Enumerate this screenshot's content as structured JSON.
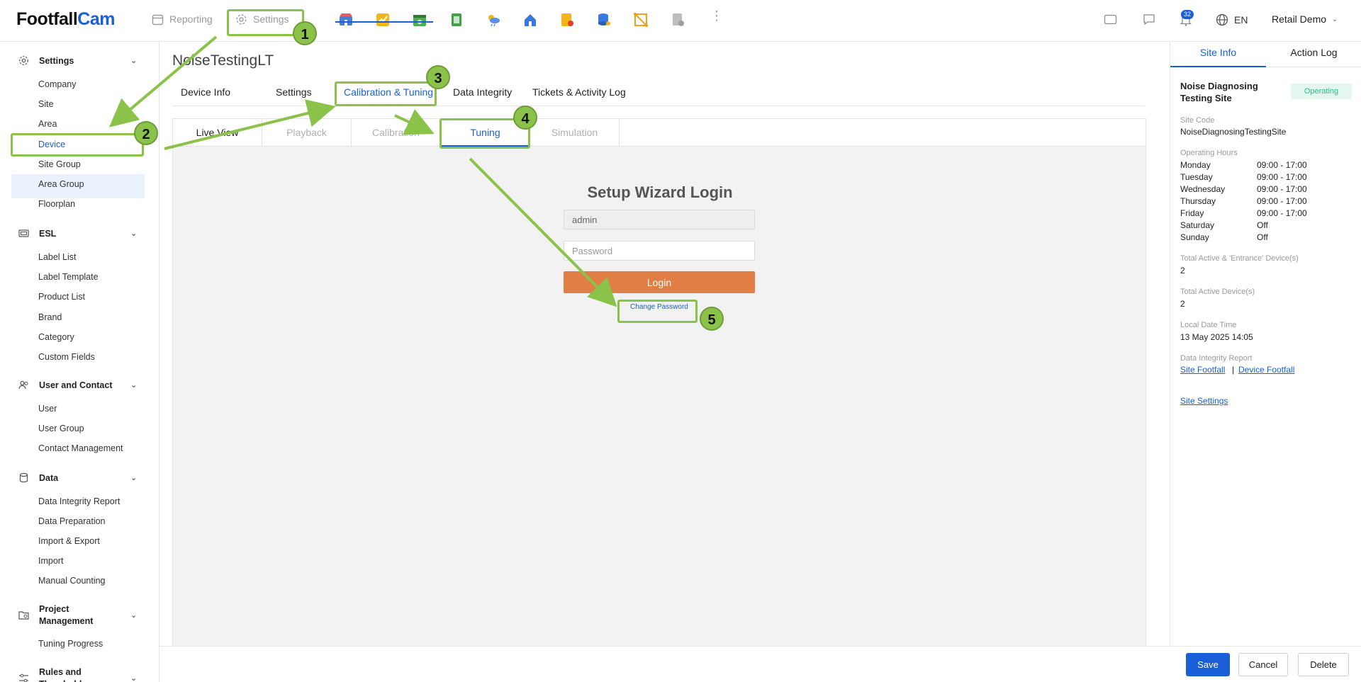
{
  "app": {
    "logo_part1": "Footfall",
    "logo_part2": "Cam",
    "nav_reporting": "Reporting",
    "nav_settings": "Settings",
    "notification_count": "32",
    "language": "EN",
    "user_name": "Retail Demo"
  },
  "app_icons": [
    "retail-store-icon",
    "analytics-chart-icon",
    "calendar-icon",
    "spreadsheet-icon",
    "weather-icon",
    "home-icon",
    "alert-document-icon",
    "database-icon",
    "floorplan-icon",
    "report-export-icon"
  ],
  "sidebar": {
    "groups": [
      {
        "label": "Settings",
        "icon": "gear-icon",
        "items": [
          "Company",
          "Site",
          "Area",
          "Device",
          "Site Group",
          "Area Group",
          "Floorplan"
        ]
      },
      {
        "label": "ESL",
        "icon": "esl-icon",
        "items": [
          "Label List",
          "Label Template",
          "Product List",
          "Brand",
          "Category",
          "Custom Fields"
        ]
      },
      {
        "label": "User and Contact",
        "icon": "users-icon",
        "items": [
          "User",
          "User Group",
          "Contact Management"
        ]
      },
      {
        "label": "Data",
        "icon": "database-icon",
        "items": [
          "Data Integrity Report",
          "Data Preparation",
          "Import & Export",
          "Import",
          "Manual Counting"
        ]
      },
      {
        "label": "Project Management",
        "icon": "project-icon",
        "items": [
          "Tuning Progress"
        ]
      },
      {
        "label": "Rules and Thresholds",
        "icon": "rules-icon",
        "items": []
      }
    ],
    "active_item": "Device"
  },
  "main": {
    "title": "NoiseTestingLT",
    "tabs": [
      "Device Info",
      "Settings",
      "Calibration & Tuning",
      "Data Integrity",
      "Tickets & Activity Log"
    ],
    "active_tab": "Calibration & Tuning",
    "sub_tabs": [
      "Live View",
      "Playback",
      "Calibration",
      "Tuning",
      "Simulation"
    ],
    "active_sub_tab": "Tuning",
    "wizard": {
      "title": "Setup Wizard Login",
      "username_value": "admin",
      "password_placeholder": "Password",
      "login_label": "Login",
      "change_password_label": "Change Password"
    }
  },
  "right_panel": {
    "tabs": [
      "Site Info",
      "Action Log"
    ],
    "site_name": "Noise Diagnosing Testing Site",
    "status": "Operating",
    "site_code_label": "Site Code",
    "site_code": "NoiseDiagnosingTestingSite",
    "operating_hours_label": "Operating Hours",
    "hours": [
      {
        "day": "Monday",
        "time": "09:00 - 17:00"
      },
      {
        "day": "Tuesday",
        "time": "09:00 - 17:00"
      },
      {
        "day": "Wednesday",
        "time": "09:00 - 17:00"
      },
      {
        "day": "Thursday",
        "time": "09:00 - 17:00"
      },
      {
        "day": "Friday",
        "time": "09:00 - 17:00"
      },
      {
        "day": "Saturday",
        "time": "Off"
      },
      {
        "day": "Sunday",
        "time": "Off"
      }
    ],
    "total_active_entrance_label": "Total Active & 'Entrance' Device(s)",
    "total_active_entrance": "2",
    "total_active_label": "Total Active Device(s)",
    "total_active": "2",
    "local_datetime_label": "Local Date Time",
    "local_datetime": "13 May 2025 14:05",
    "data_integrity_label": "Data Integrity Report",
    "link_site_footfall": "Site Footfall",
    "link_separator": "|",
    "link_device_footfall": "Device Footfall",
    "link_site_settings": "Site Settings"
  },
  "footer": {
    "save": "Save",
    "cancel": "Cancel",
    "delete": "Delete"
  },
  "annotations": {
    "markers": [
      "1",
      "2",
      "3",
      "4",
      "5"
    ],
    "highlight_color": "#8bc34a"
  }
}
